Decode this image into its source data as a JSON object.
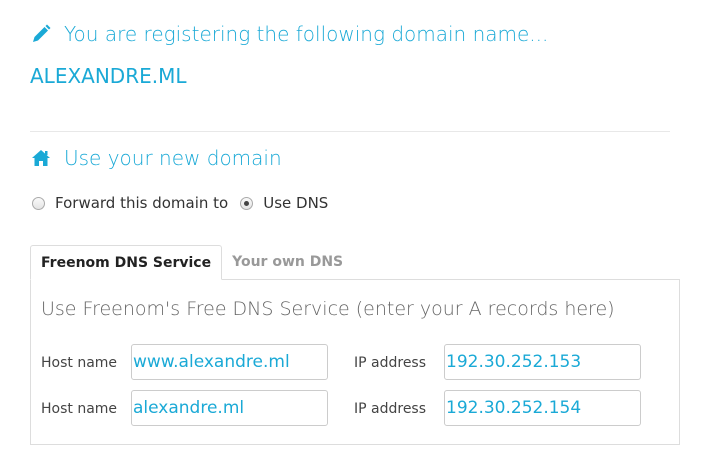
{
  "registering": {
    "icon": "pencil-icon",
    "title": "You are registering the following domain name...",
    "domain": "ALEXANDRE.ML"
  },
  "use_domain": {
    "icon": "home-icon",
    "title": "Use your new domain",
    "options": [
      {
        "label": "Forward this domain to",
        "checked": false
      },
      {
        "label": "Use DNS",
        "checked": true
      }
    ]
  },
  "tabs": [
    {
      "label": "Freenom DNS Service",
      "active": true
    },
    {
      "label": "Your own DNS",
      "active": false
    }
  ],
  "panel": {
    "title": "Use Freenom's Free DNS Service (enter your A records here)",
    "rows": [
      {
        "host_label": "Host name",
        "host_value": "www.alexandre.ml",
        "ip_label": "IP address",
        "ip_value": "192.30.252.153"
      },
      {
        "host_label": "Host name",
        "host_value": "alexandre.ml",
        "ip_label": "IP address",
        "ip_value": "192.30.252.154"
      }
    ]
  },
  "colors": {
    "accent": "#1aa9d6"
  }
}
